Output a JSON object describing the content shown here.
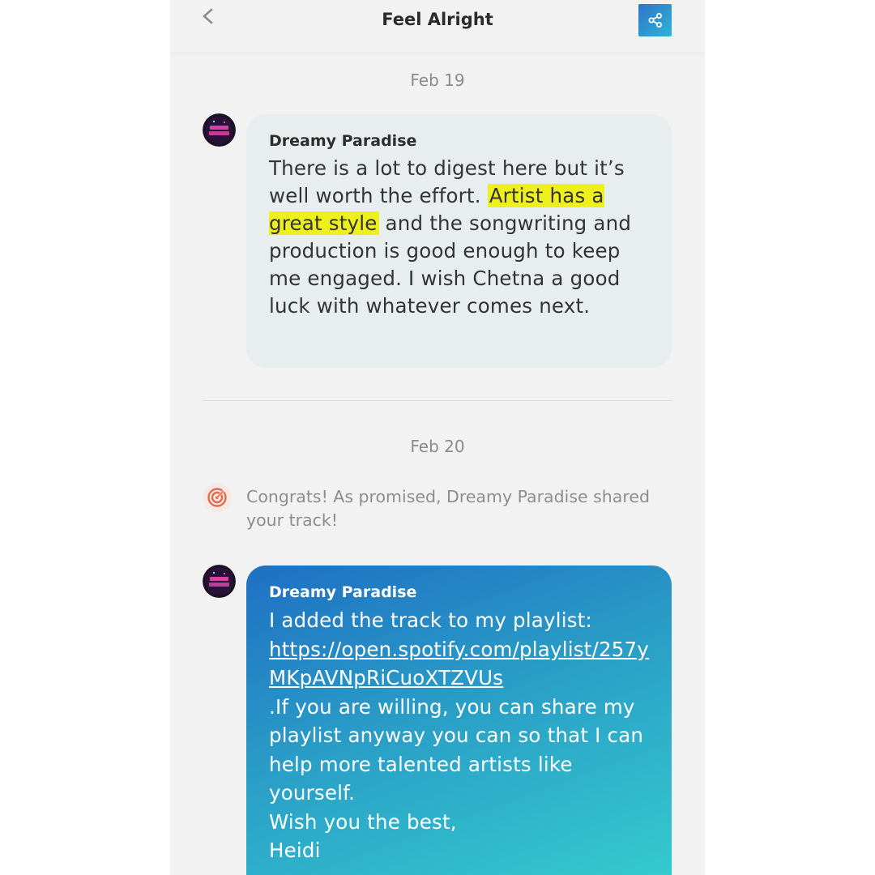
{
  "header": {
    "title": "Feel Alright"
  },
  "conversation": {
    "date1": "Feb 19",
    "message1": {
      "author": "Dreamy Paradise",
      "text_before": "There is a lot to digest here but it’s well worth the effort. ",
      "highlight": "Artist has a great style",
      "text_after": " and the songwriting and production is good enough to keep me engaged. I wish Chetna a good luck with whatever comes next."
    },
    "date2": "Feb 20",
    "notice": "Congrats! As promised, Dreamy Paradise shared your track!",
    "message2": {
      "author": "Dreamy Paradise",
      "intro": "I added the track to my playlist:",
      "link": "https://open.spotify.com/playlist/257yMKpAVNpRiCuoXTZVUs",
      "body": ".If you are willing, you can share my playlist anyway you can so that I can help more talented artists like yourself.",
      "closing": "Wish you the best,",
      "signature": "Heidi"
    }
  },
  "icons": {
    "back": "chevron-left-icon",
    "share": "share-icon",
    "notice": "target-icon"
  },
  "colors": {
    "highlight": "#eef01c",
    "accent": "#2a9fc7",
    "grey_bubble": "#e8eeee"
  }
}
